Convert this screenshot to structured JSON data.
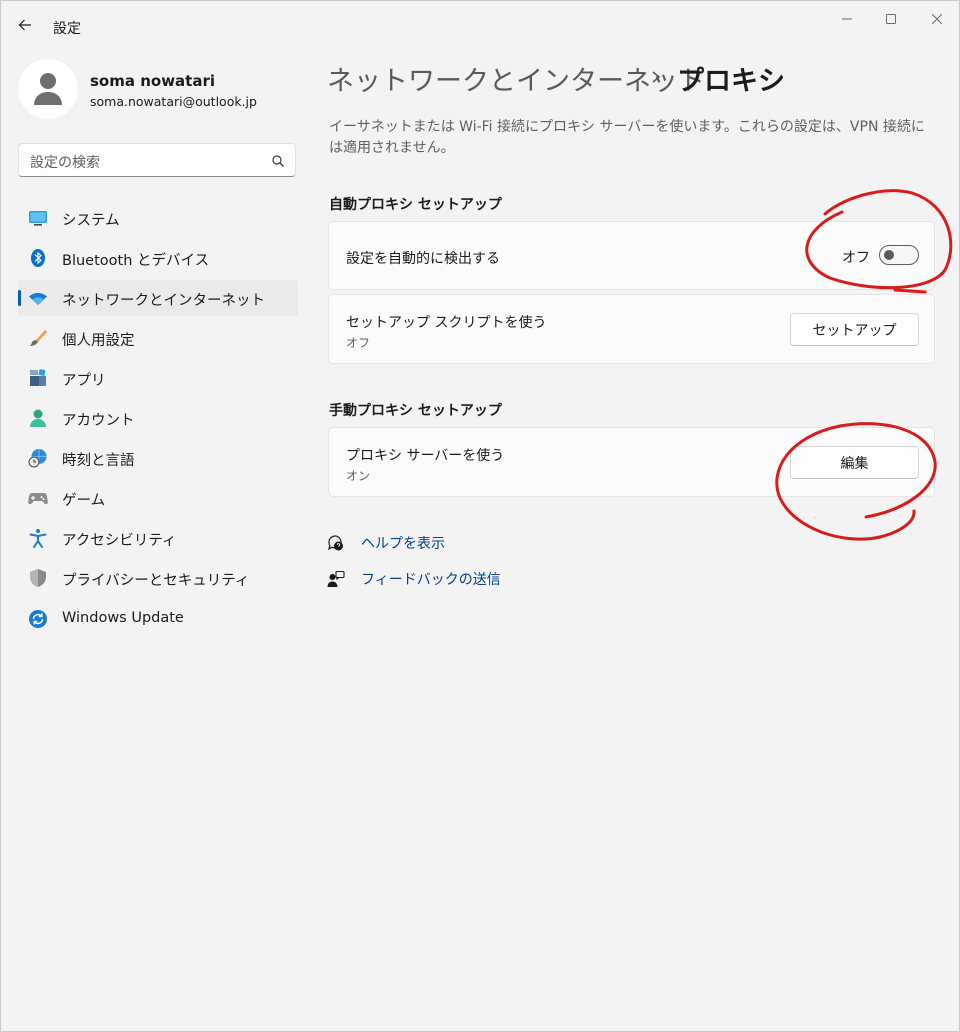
{
  "window": {
    "title": "設定",
    "accent": "#005fb8",
    "annotation_color": "#d81b1b"
  },
  "user": {
    "name": "soma nowatari",
    "email": "soma.nowatari@outlook.jp"
  },
  "search": {
    "placeholder": "設定の検索"
  },
  "sidebar": {
    "items": [
      {
        "label": "システム",
        "icon": "system-icon"
      },
      {
        "label": "Bluetooth とデバイス",
        "icon": "bluetooth-icon"
      },
      {
        "label": "ネットワークとインターネット",
        "icon": "network-icon",
        "selected": true
      },
      {
        "label": "個人用設定",
        "icon": "brush-icon"
      },
      {
        "label": "アプリ",
        "icon": "apps-icon"
      },
      {
        "label": "アカウント",
        "icon": "account-icon"
      },
      {
        "label": "時刻と言語",
        "icon": "time-language-icon"
      },
      {
        "label": "ゲーム",
        "icon": "gamepad-icon"
      },
      {
        "label": "アクセシビリティ",
        "icon": "accessibility-icon"
      },
      {
        "label": "プライバシーとセキュリティ",
        "icon": "shield-icon"
      },
      {
        "label": "Windows Update",
        "icon": "update-icon"
      }
    ]
  },
  "header": {
    "parent": "ネットワークとインターネット",
    "current": "プロキシ"
  },
  "description": "イーサネットまたは Wi-Fi 接続にプロキシ サーバーを使います。これらの設定は、VPN 接続には適用されません。",
  "auto_proxy": {
    "heading": "自動プロキシ セットアップ",
    "detect": {
      "title": "設定を自動的に検出する",
      "state_label": "オフ",
      "on": false
    },
    "script": {
      "title": "セットアップ スクリプトを使う",
      "status": "オフ",
      "button": "セットアップ"
    }
  },
  "manual_proxy": {
    "heading": "手動プロキシ セットアップ",
    "use_server": {
      "title": "プロキシ サーバーを使う",
      "status": "オン",
      "button": "編集"
    }
  },
  "links": {
    "help": "ヘルプを表示",
    "feedback": "フィードバックの送信"
  }
}
